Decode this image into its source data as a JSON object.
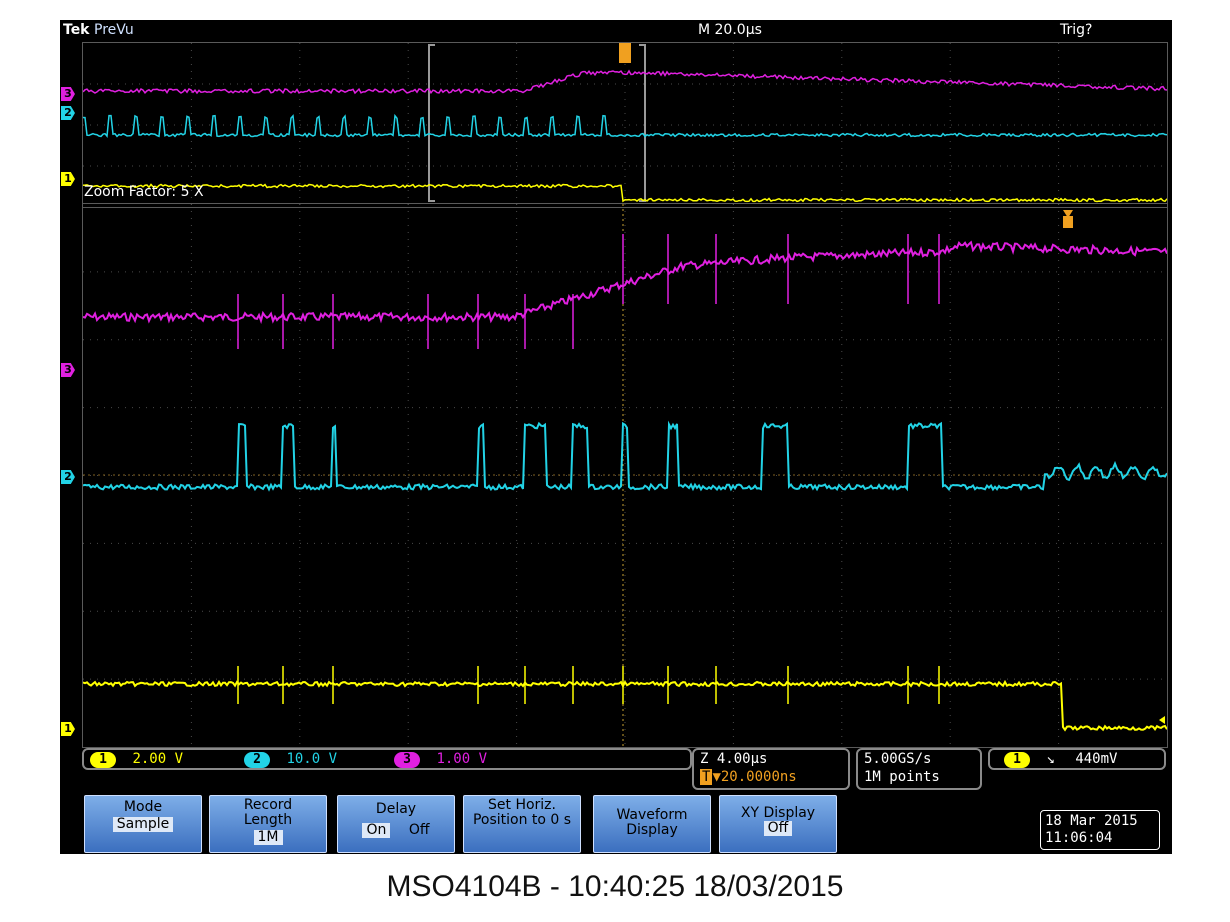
{
  "header": {
    "brand": "Tek",
    "mode": "PreVu",
    "timebase": "M 20.0µs",
    "trigger_status": "Trig?"
  },
  "zoom": {
    "label": "Zoom Factor: 5 X"
  },
  "channels": [
    {
      "id": "1",
      "scale": "2.00 V",
      "color": "#ffff00"
    },
    {
      "id": "2",
      "scale": "10.0 V",
      "color": "#22d3e6"
    },
    {
      "id": "3",
      "scale": "1.00 V",
      "color": "#e020e0"
    }
  ],
  "zoom_timebase": {
    "scale": "Z 4.00µs",
    "trigger_offset": "▼20.0000ns",
    "trigger_icon": "T"
  },
  "acquisition": {
    "rate": "5.00GS/s",
    "points": "1M points"
  },
  "trigger": {
    "channel": "1",
    "slope_icon": "↘",
    "level": "440mV"
  },
  "menu": [
    {
      "label": "Mode",
      "value": "Sample"
    },
    {
      "label": "Record Length",
      "value": "1M"
    },
    {
      "label": "Delay",
      "on": "On",
      "off": "Off"
    },
    {
      "label": "Set Horiz. Position to 0 s"
    },
    {
      "label": "Waveform Display"
    },
    {
      "label": "XY Display",
      "value": "Off"
    }
  ],
  "datetime": {
    "date": "18 Mar 2015",
    "time": "11:06:04"
  },
  "footer": {
    "caption": "MSO4104B - 10:40:25   18/03/2015"
  },
  "colors": {
    "ch1": "#ffff00",
    "ch2": "#22d3e6",
    "ch3": "#e020e0",
    "trigger": "#f0a020",
    "grid": "#4a4a4a"
  }
}
